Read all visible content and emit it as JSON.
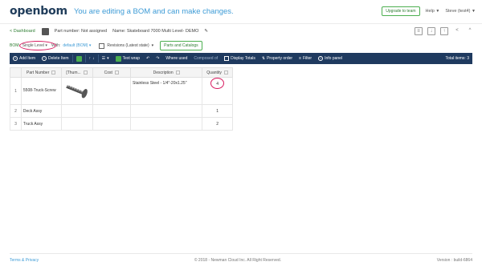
{
  "header": {
    "logo": "openbom",
    "message": "You are editing a BOM and can make changes.",
    "upgrade_label": "Upgrade to team",
    "help_label": "Help",
    "user_label": "Steve (test4)"
  },
  "info": {
    "dashboard_label": "< Dashboard",
    "part_number": "Part number: Not assigned",
    "name": "Name: Skateboard 7000 Multi Level- DEMO"
  },
  "selection": {
    "bom_label": "BOM:",
    "level_value": "Single Level",
    "with_label": "With:",
    "view_value": "default (BOM)",
    "revisions_label": "Revisions (Latest state)",
    "parts_catalogs_label": "Parts and Catalogs"
  },
  "toolbar": {
    "add_item": "Add Item",
    "delete_item": "Delete Item",
    "text_wrap": "Text wrap",
    "where_used": "Where used",
    "composed_of": "Composed of",
    "display_totals": "Display Totals",
    "property_order": "Property order",
    "filter": "Filter",
    "info_panel": "Info panel",
    "total_items": "Total items: 3"
  },
  "grid": {
    "columns": [
      "Part Number",
      "[Thum...",
      "Cost",
      "Description",
      "Quantity"
    ],
    "rows": [
      {
        "index": "1",
        "part_number": "5508-Truck-Screw",
        "cost": "",
        "description": "Stainless Steel - 1/4\"-20x1.25\"",
        "quantity": "4"
      },
      {
        "index": "2",
        "part_number": "Deck Assy",
        "cost": "",
        "description": "",
        "quantity": "1"
      },
      {
        "index": "3",
        "part_number": "Truck Assy",
        "cost": "",
        "description": "",
        "quantity": "2"
      }
    ]
  },
  "footer": {
    "terms": "Terms & Privacy",
    "copyright": "© 2018 - Newman Cloud Inc. All Right Reserved.",
    "version": "Version : build-6864"
  },
  "colors": {
    "navy": "#1f3a5f",
    "green": "#4caf50",
    "link_blue": "#3d9bd6",
    "highlight_pink": "#d81b60"
  }
}
